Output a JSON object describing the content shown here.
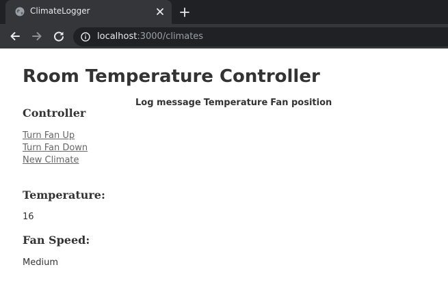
{
  "browser": {
    "tab_title": "ClimateLogger",
    "url_host": "localhost",
    "url_path": ":3000/climates",
    "icons": {
      "favicon": "globe-icon",
      "close": "close-icon",
      "new_tab": "plus-icon",
      "back": "arrow-left-icon",
      "forward": "arrow-right-icon",
      "reload": "reload-icon",
      "info": "info-icon"
    }
  },
  "page": {
    "title": "Room Temperature Controller",
    "controller": {
      "heading": "Controller",
      "links": [
        "Turn Fan Up",
        "Turn Fan Down",
        "New Climate"
      ]
    },
    "temperature": {
      "heading": "Temperature:",
      "value": "16"
    },
    "fan_speed": {
      "heading": "Fan Speed:",
      "value": "Medium"
    },
    "log_table": {
      "headers": [
        "Log message",
        "Temperature",
        "Fan position"
      ]
    }
  }
}
